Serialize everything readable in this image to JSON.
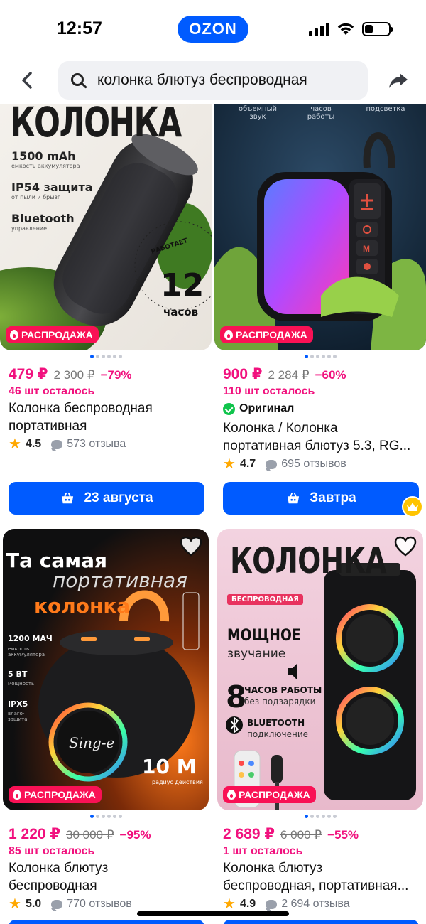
{
  "status_bar": {
    "time": "12:57",
    "app_badge": "OZON",
    "battery_level": 0.35
  },
  "search": {
    "query": "колонка блютуз беспроводная",
    "back_icon": "chevron-left-icon",
    "share_icon": "share-arrow-icon"
  },
  "colors": {
    "brand_blue": "#005bff",
    "price_pink": "#f1117e",
    "sale_red": "#f91155",
    "star_orange": "#ffa800"
  },
  "products": [
    {
      "image_heading": "КОЛОНКА",
      "image_specs": [
        "1500 mAh",
        "емкость аккумулятора",
        "IP54 защита",
        "от пыли и брызг",
        "Bluetooth",
        "управление"
      ],
      "image_hours": "12",
      "image_hours_label": "часов",
      "image_ring_text": "РАБОТАЕТ",
      "badge": "РАСПРОДАЖА",
      "price": "479 ₽",
      "old_price": "2 300 ₽",
      "discount": "−79%",
      "stock": "46 шт осталось",
      "title_line1": "Колонка беспроводная",
      "title_line2": "портативная",
      "rating": "4.5",
      "reviews": "573 отзыва",
      "delivery": "23 августа"
    },
    {
      "image_features": [
        "объемный звук",
        "часов работы",
        "подсветка"
      ],
      "badge": "РАСПРОДАЖА",
      "price": "900 ₽",
      "old_price": "2 284 ₽",
      "discount": "−60%",
      "stock": "110 шт осталось",
      "original_label": "Оригинал",
      "title_line1": "Колонка / Колонка",
      "title_line2": "портативная блютуз 5.3, RG...",
      "rating": "4.7",
      "reviews": "695 отзывов",
      "delivery": "Завтра"
    },
    {
      "image_title1": "Та самая",
      "image_title2": "портативная",
      "image_title3": "колонка",
      "image_specs": [
        "1200 МАЧ",
        "емкость аккумулятора",
        "5 ВТ",
        "мощность",
        "IPX5",
        "влаго-защита"
      ],
      "image_range": "10 M",
      "image_range_label": "радиус действия",
      "image_brand": "Sing-e",
      "badge": "РАСПРОДАЖА",
      "price": "1 220 ₽",
      "old_price": "30 000 ₽",
      "discount": "−95%",
      "stock": "85 шт осталось",
      "title_line1": "Колонка блютуз",
      "title_line2": "беспроводная",
      "rating": "5.0",
      "reviews": "770 отзывов"
    },
    {
      "image_title": "КОЛОНКА",
      "image_subtitle": "БЕСПРОВОДНАЯ",
      "image_power": "МОЩНОЕ",
      "image_power_sub": "звучание",
      "image_hours_num": "8",
      "image_hours": "ЧАСОВ РАБОТЫ",
      "image_hours_sub": "без подзарядки",
      "image_bt": "BLUETOOTH",
      "image_bt_sub": "подключение",
      "badge": "РАСПРОДАЖА",
      "price": "2 689 ₽",
      "old_price": "6 000 ₽",
      "discount": "−55%",
      "stock": "1 шт осталось",
      "title_line1": "Колонка блютуз",
      "title_line2": "беспроводная, портативная...",
      "rating": "4.9",
      "reviews": "2 694 отзыва"
    }
  ]
}
